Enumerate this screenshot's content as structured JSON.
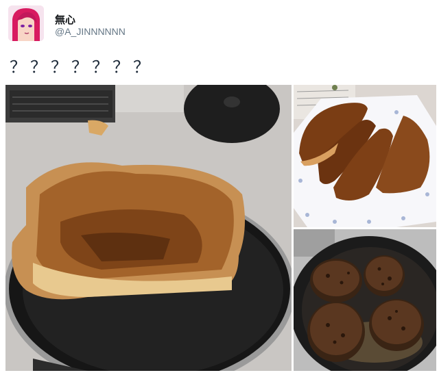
{
  "user": {
    "display_name": "無心",
    "handle": "@A_JINNNNNN"
  },
  "tweet": {
    "text": "？？？？？？？"
  },
  "media": {
    "photos": [
      {
        "subject": "pancake-in-pan-photo"
      },
      {
        "subject": "dorayaki-on-plate-photo"
      },
      {
        "subject": "hamburg-steaks-in-pan-photo"
      }
    ]
  }
}
